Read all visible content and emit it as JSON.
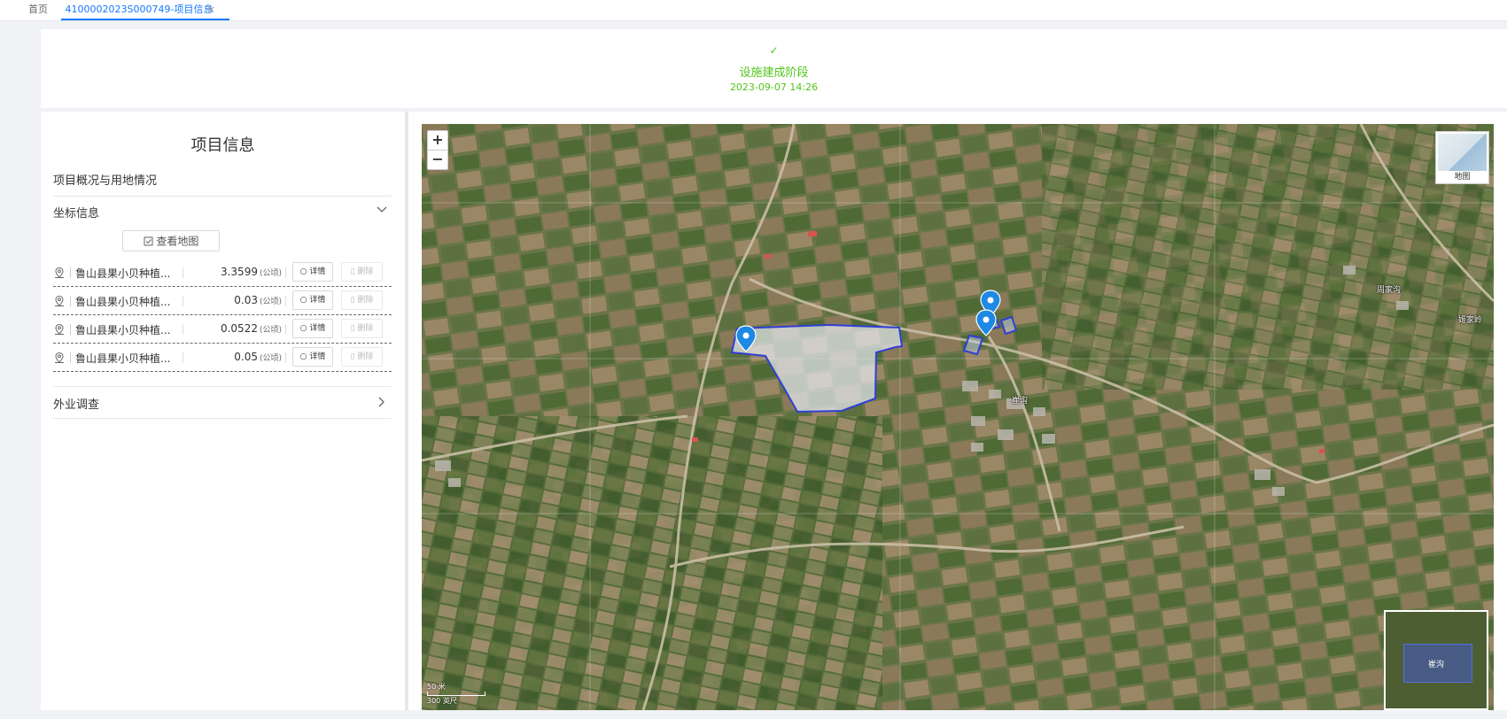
{
  "tabs": {
    "home": "首页",
    "active": "4100002023S000749-项目信息",
    "close": "×"
  },
  "stage": {
    "check": "✓",
    "title": "设施建成阶段",
    "date": "2023-09-07 14:26",
    "color": "#52c41a"
  },
  "panel": {
    "title": "项目信息",
    "overview_section": "项目概况与用地情况",
    "coord_section": "坐标信息",
    "view_map_label": "查看地图",
    "field_section": "外业调查",
    "detail_label": "详情",
    "delete_label": "删除",
    "unit": "(公顷)",
    "plots": [
      {
        "name": "鲁山县果小贝种植...",
        "area": "3.3599"
      },
      {
        "name": "鲁山县果小贝种植...",
        "area": "0.03"
      },
      {
        "name": "鲁山县果小贝种植...",
        "area": "0.0522"
      },
      {
        "name": "鲁山县果小贝种植...",
        "area": "0.05"
      }
    ]
  },
  "map": {
    "zoom_in": "+",
    "zoom_out": "−",
    "layer_label": "地图",
    "villages": [
      "周家沟",
      "姬家岭",
      "崔沟"
    ],
    "overview_label": "崔沟",
    "scale_top": "50 米",
    "scale_bottom": "300 英尺",
    "polygon_color": "#2f3fd6",
    "accent": "#1677ff"
  }
}
